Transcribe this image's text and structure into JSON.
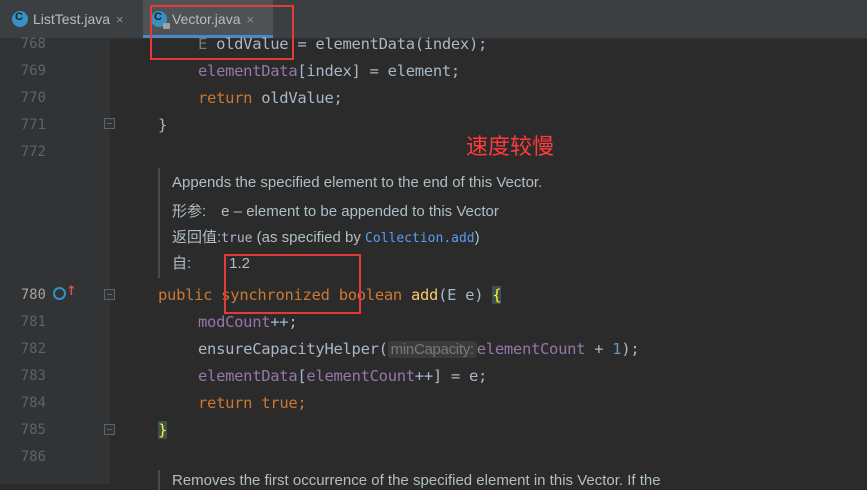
{
  "tabs": [
    {
      "label": "ListTest.java",
      "close": "×",
      "active": false
    },
    {
      "label": "Vector.java",
      "close": "×",
      "active": true
    }
  ],
  "line_numbers": [
    "768",
    "769",
    "770",
    "771",
    "772",
    "780",
    "781",
    "782",
    "783",
    "784",
    "785",
    "786"
  ],
  "code": {
    "l768": [
      "E",
      " oldValue = elementData(index);"
    ],
    "l769": [
      "elementData",
      "[index] = element;"
    ],
    "l770": [
      "return",
      " oldValue;"
    ],
    "l771": "}",
    "l780": [
      "public",
      "synchronized",
      "boolean",
      "add",
      "(E e)",
      "{"
    ],
    "l781": [
      "modCount",
      "++;"
    ],
    "l782": [
      "ensureCapacityHelper(",
      "minCapacity:",
      "elementCount",
      " + ",
      "1",
      ");"
    ],
    "l783": [
      "elementData",
      "[",
      "elementCount",
      "++] = e;"
    ],
    "l784": [
      "return",
      "true",
      ";"
    ],
    "l785": "}"
  },
  "javadoc": {
    "summary": "Appends the specified element to the end of this Vector.",
    "param_label": "形参:",
    "param_text": "e – element to be appended to this Vector",
    "return_label": "返回值:",
    "return_code": "true",
    "return_text_1": " (as specified by ",
    "return_link": "Collection.add",
    "return_text_2": ")",
    "since_label": "自:",
    "since_value": "1.2",
    "next_partial": "Removes the first occurrence of the specified element in this Vector. If the"
  },
  "annotation_note": "速度较慢",
  "colors": {
    "background": "#2b2b2b",
    "keyword": "#cc7832",
    "field": "#9876aa",
    "number": "#6897bb",
    "highlight_box": "#e33b3b",
    "note": "#ff3b3b"
  },
  "icons": [
    "java-class-icon",
    "implementation-gutter-icon",
    "fold-marker-icon"
  ]
}
